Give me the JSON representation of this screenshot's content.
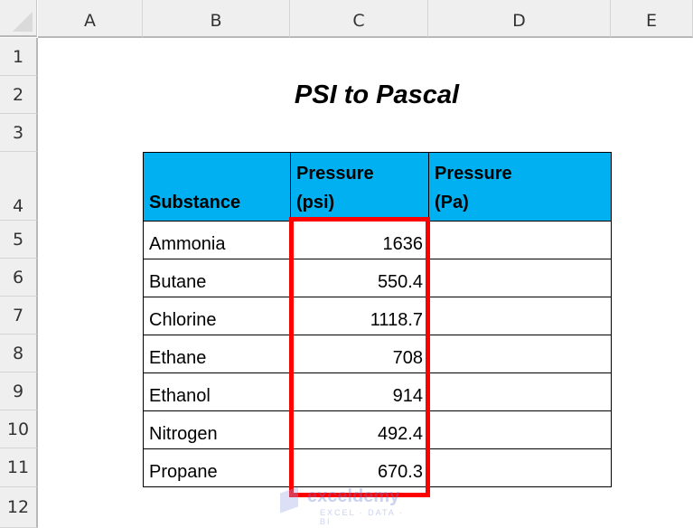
{
  "columns": [
    "A",
    "B",
    "C",
    "D",
    "E"
  ],
  "rows": [
    "1",
    "2",
    "3",
    "4",
    "5",
    "6",
    "7",
    "8",
    "9",
    "10",
    "11",
    "12"
  ],
  "title": "PSI to Pascal",
  "table": {
    "headers": [
      "Substance",
      "Pressure (psi)",
      "Pressure (Pa)"
    ],
    "rows": [
      {
        "substance": "Ammonia",
        "psi": "1636",
        "pa": ""
      },
      {
        "substance": "Butane",
        "psi": "550.4",
        "pa": ""
      },
      {
        "substance": "Chlorine",
        "psi": "1118.7",
        "pa": ""
      },
      {
        "substance": "Ethane",
        "psi": "708",
        "pa": ""
      },
      {
        "substance": "Ethanol",
        "psi": "914",
        "pa": ""
      },
      {
        "substance": "Nitrogen",
        "psi": "492.4",
        "pa": ""
      },
      {
        "substance": "Propane",
        "psi": "670.3",
        "pa": ""
      }
    ]
  },
  "header_fill": "#00b0f0",
  "highlight_color": "#ff0000",
  "watermark": {
    "name": "exceldemy",
    "tagline": "EXCEL · DATA · BI"
  }
}
